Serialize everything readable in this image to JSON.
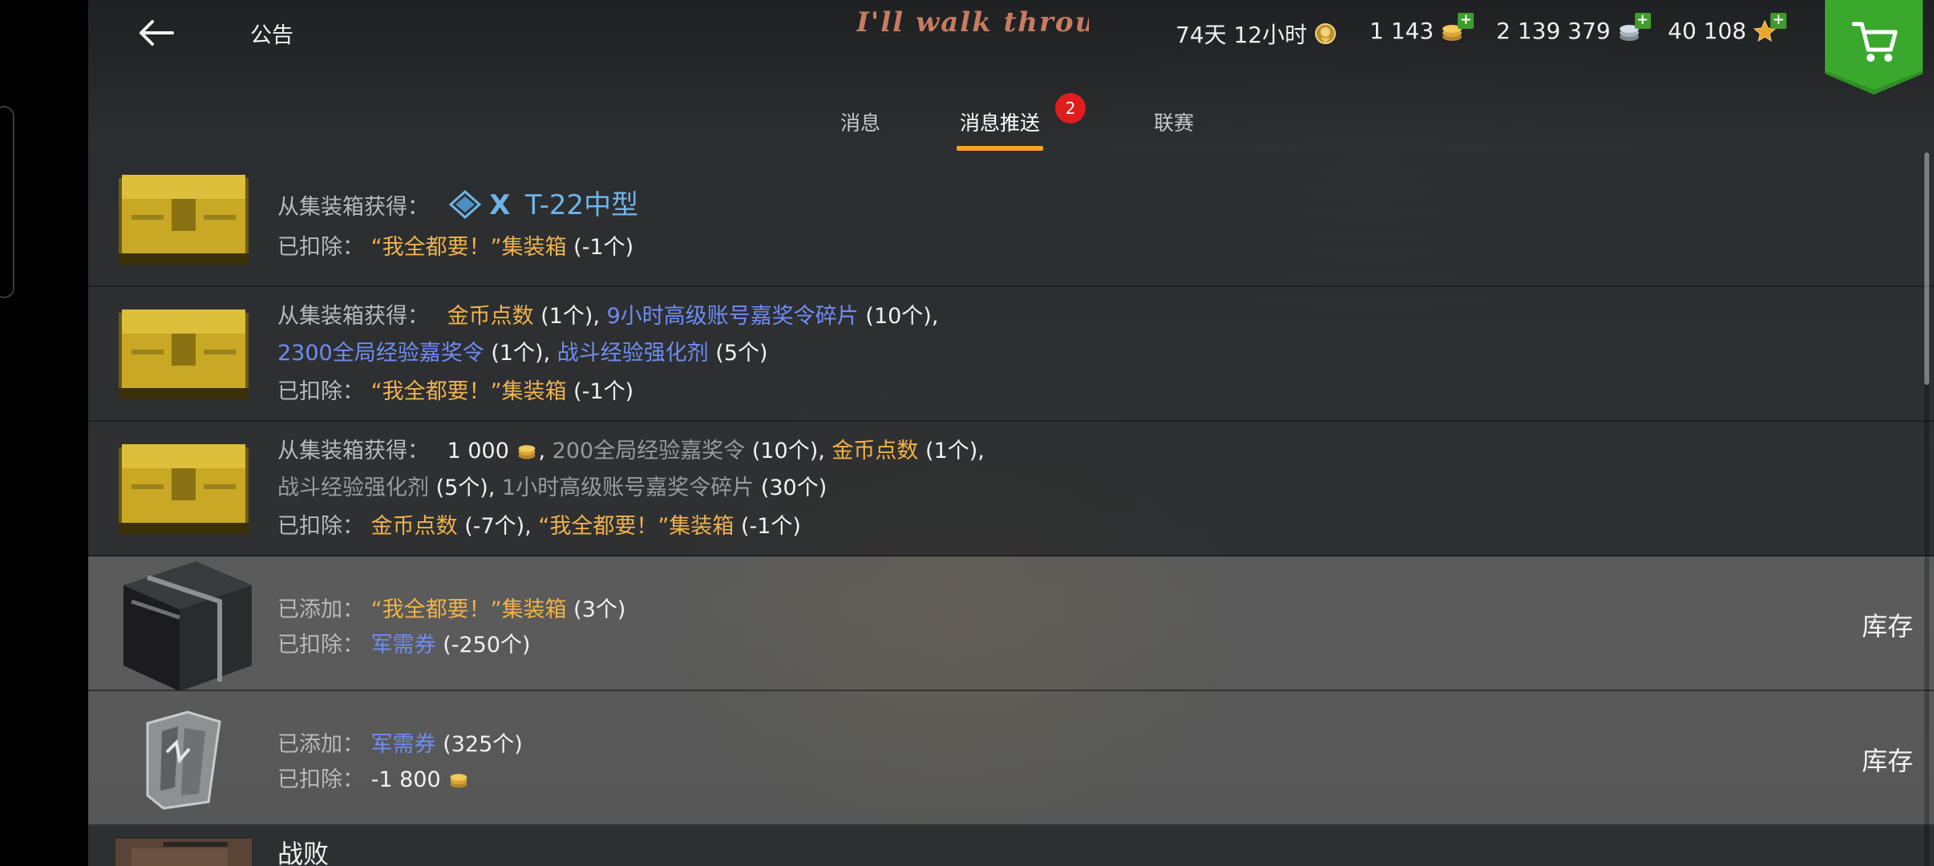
{
  "header": {
    "title": "公告",
    "player_name": "I'll walk through",
    "premium_time": "74天 12小时",
    "gold": "1 143",
    "credits": "2 139 379",
    "free_xp": "40 108"
  },
  "tabs": [
    {
      "label": "消息"
    },
    {
      "label": "消息推送",
      "badge": "2"
    },
    {
      "label": "联赛"
    }
  ],
  "messages": [
    {
      "obtained_label": "从集装箱获得：",
      "tank_tier": "X",
      "tank_name": "T-22中型",
      "deducted_label": "已扣除：",
      "deducted_item": "“我全都要！”集装箱",
      "deducted_qty": "(-1个)"
    },
    {
      "obtained_label": "从集装箱获得：",
      "r1_item1": "金币点数",
      "r1_qty1": "(1个)",
      "r1_item2": "9小时高级账号嘉奖令碎片",
      "r1_qty2": "(10个)",
      "r1_item3": "2300全局经验嘉奖令",
      "r1_qty3": "(1个)",
      "r1_item4": "战斗经验强化剂",
      "r1_qty4": "(5个)",
      "deducted_label": "已扣除：",
      "deducted_item": "“我全都要！”集装箱",
      "deducted_qty": "(-1个)"
    },
    {
      "obtained_label": "从集装箱获得：",
      "credits_amount": "1 000",
      "item1": "200全局经验嘉奖令",
      "qty1": "(10个)",
      "item2": "金币点数",
      "qty2": "(1个)",
      "item3": "战斗经验强化剂",
      "qty3": "(5个)",
      "item4": "1小时高级账号嘉奖令碎片",
      "qty4": "(30个)",
      "deducted_label": "已扣除：",
      "deducted_item1": "金币点数",
      "deducted_qty1": "(-7个)",
      "deducted_item2": "“我全都要！”集装箱",
      "deducted_qty2": "(-1个)"
    },
    {
      "added_label": "已添加：",
      "added_item": "“我全都要！”集装箱",
      "added_qty": "(3个)",
      "deducted_label": "已扣除：",
      "deducted_item": "军需券",
      "deducted_qty": "(-250个)",
      "action": "库存"
    },
    {
      "added_label": "已添加：",
      "added_item": "军需券",
      "added_qty": "(325个)",
      "deducted_label": "已扣除：",
      "deducted_amount": "-1 800",
      "action": "库存"
    },
    {
      "title": "战败"
    }
  ],
  "colors": {
    "accent_tab": "#f5a623",
    "item_gold": "#f0b24a",
    "item_blue": "#6f8df2",
    "tank_blue": "#6fb4e6",
    "badge_red": "#e01d1d",
    "shop_green": "#2f8f24"
  },
  "icons": {
    "back": "arrow-left-icon",
    "premium": "premium-medal-icon",
    "gold": "gold-coins-icon",
    "credits": "silver-coins-icon",
    "free_xp": "star-icon",
    "shop": "shopping-cart-icon"
  }
}
